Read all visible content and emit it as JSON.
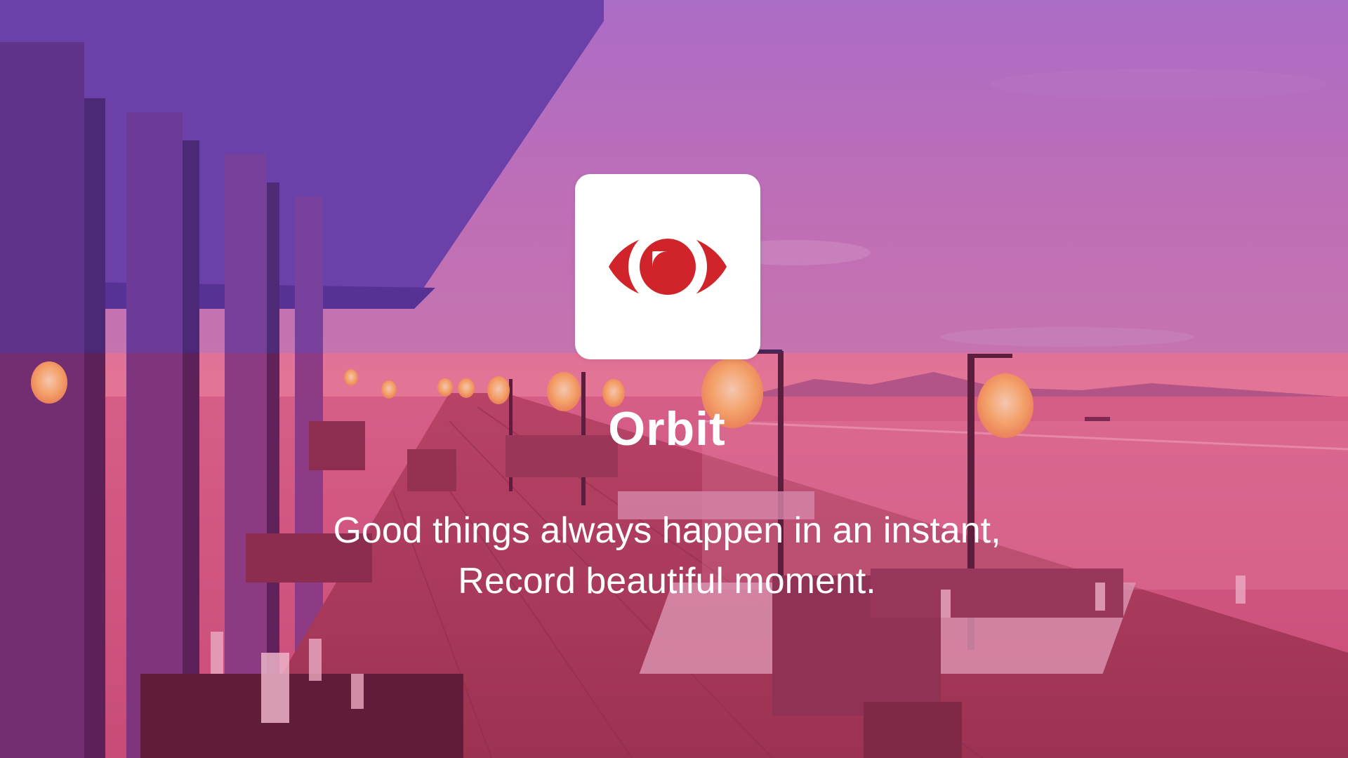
{
  "splash": {
    "app_name": "Orbit",
    "tagline_line1": "Good things always happen in an instant,",
    "tagline_line2": "Record beautiful moment.",
    "logo_icon": "eye-icon"
  },
  "colors": {
    "brand_red": "#d0232a",
    "icon_background": "#ffffff",
    "text": "#ffffff",
    "overlay_top": "#7a56c8",
    "overlay_bottom": "#d93a6e"
  }
}
